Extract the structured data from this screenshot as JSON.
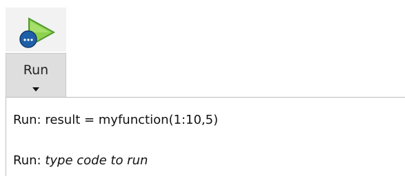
{
  "run_button": {
    "label": "Run",
    "icon": "run-play-icon",
    "dropdown_icon": "caret-down-icon",
    "colors": {
      "play_green": "#8fd14f",
      "badge_blue": "#1f5fa8"
    }
  },
  "run_menu": {
    "items": [
      {
        "prefix": "Run:",
        "text": "result = myfunction(1:10,5)"
      },
      {
        "prefix": "Run:",
        "placeholder": "type code to run"
      }
    ]
  }
}
